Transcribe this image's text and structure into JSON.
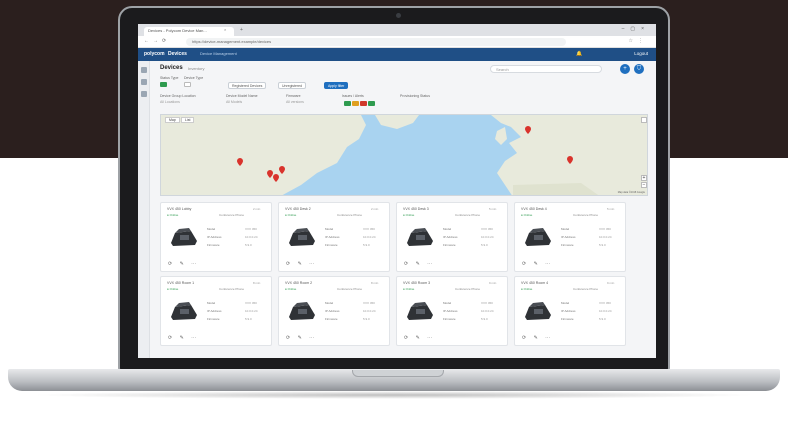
{
  "browser": {
    "tab_title": "Devices - Polycom Device Man...",
    "tab_close": "×",
    "new_tab": "+",
    "window_buttons": [
      "–",
      "▢",
      "×"
    ],
    "nav": [
      "←",
      "→",
      "⟳"
    ],
    "url": "https://device-management.example/devices",
    "icons": [
      "☆",
      "⋮"
    ]
  },
  "app": {
    "logo": "polycom",
    "title": "Devices",
    "crumb": "Device Management",
    "bell": "🔔",
    "user": "Logout"
  },
  "page": {
    "title": "Devices",
    "subtitle": "Inventory",
    "search_placeholder": "Search",
    "fab_add": "+",
    "fab_filter": "⛉"
  },
  "filters": {
    "group1_label": "Status Type",
    "group2_label": "Device Type",
    "chip1": "Registered Devices",
    "chip2": "Unregistered",
    "chip3": "Apply filter",
    "row2": [
      {
        "label": "Device Group Location",
        "value": "All Locations"
      },
      {
        "label": "Device Model Name",
        "value": "All Models"
      },
      {
        "label": "Firmware",
        "value": "All versions"
      },
      {
        "label": "Issues / Alerts",
        "value": ""
      },
      {
        "label": "Provisioning Status",
        "value": ""
      }
    ],
    "status_colors": [
      "#2e9b4f",
      "#e0a020",
      "#d0392b",
      "#2e9b4f"
    ]
  },
  "map": {
    "tab_map": "Map",
    "tab_list": "List",
    "zoom_in": "+",
    "zoom_out": "−",
    "attribution": "Map data ©2018 Google",
    "land_color": "#e8eadc",
    "water_color": "#a9d3f0",
    "marker_color": "#d9332c"
  },
  "cards": [
    {
      "name": "VVX 450 Lobby",
      "status": "● Online",
      "category": "Conference Phone",
      "time": "2 min"
    },
    {
      "name": "VVX 450 Desk 2",
      "status": "● Online",
      "category": "Conference Phone",
      "time": "2 min"
    },
    {
      "name": "VVX 450 Desk 3",
      "status": "● Online",
      "category": "Conference Phone",
      "time": "5 min"
    },
    {
      "name": "VVX 450 Desk 4",
      "status": "● Online",
      "category": "Conference Phone",
      "time": "5 min"
    },
    {
      "name": "VVX 450 Room 1",
      "status": "● Online",
      "category": "Conference Phone",
      "time": "8 min"
    },
    {
      "name": "VVX 450 Room 2",
      "status": "● Online",
      "category": "Conference Phone",
      "time": "8 min"
    },
    {
      "name": "VVX 450 Room 3",
      "status": "● Online",
      "category": "Conference Phone",
      "time": "9 min"
    },
    {
      "name": "VVX 450 Room 4",
      "status": "● Online",
      "category": "Conference Phone",
      "time": "9 min"
    }
  ],
  "card_kv": [
    {
      "label": "Model",
      "value": "VVX 450"
    },
    {
      "label": "IP Address",
      "value": "10.0.0.24"
    },
    {
      "label": "Firmware",
      "value": "5.9.0"
    }
  ],
  "card_actions": "⟳ ✎ ⋯"
}
